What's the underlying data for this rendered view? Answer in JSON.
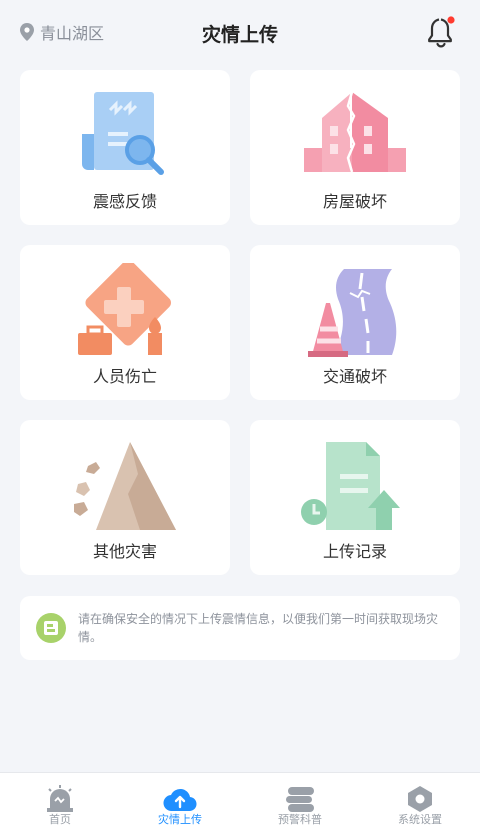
{
  "header": {
    "location": "青山湖区",
    "title": "灾情上传"
  },
  "cards": [
    {
      "label": "震感反馈",
      "icon": "document-search-icon"
    },
    {
      "label": "房屋破坏",
      "icon": "cracked-building-icon"
    },
    {
      "label": "人员伤亡",
      "icon": "first-aid-icon"
    },
    {
      "label": "交通破坏",
      "icon": "cracked-road-icon"
    },
    {
      "label": "其他灾害",
      "icon": "landslide-icon"
    },
    {
      "label": "上传记录",
      "icon": "upload-record-icon"
    }
  ],
  "notice": {
    "text": "请在确保安全的情况下上传震情信息，以便我们第一时间获取现场灾情。"
  },
  "tabbar": [
    {
      "label": "首页",
      "icon": "alarm-icon",
      "active": false
    },
    {
      "label": "灾情上传",
      "icon": "cloud-upload-icon",
      "active": true
    },
    {
      "label": "预警科普",
      "icon": "book-icon",
      "active": false
    },
    {
      "label": "系统设置",
      "icon": "settings-icon",
      "active": false
    }
  ],
  "colors": {
    "accent": "#1f8fff",
    "background": "#f3f5f9",
    "notification_dot": "#ff3b30"
  }
}
